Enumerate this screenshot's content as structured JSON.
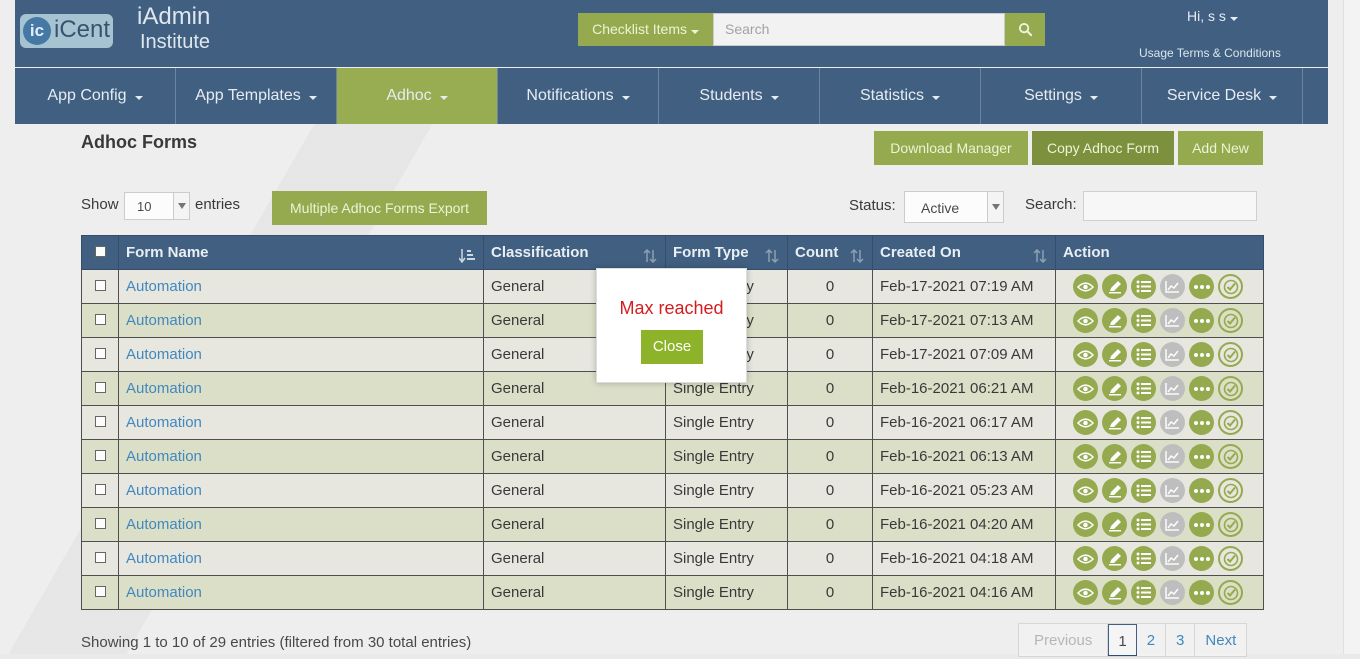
{
  "header": {
    "logo_text": "iCent",
    "logo_mark": "ic",
    "brand_title": "iAdmin",
    "brand_subtitle": "Institute",
    "checklist_button": "Checklist Items",
    "search_placeholder": "Search",
    "greeting": "Hi, s s",
    "terms_link": "Usage Terms & Conditions",
    "colors": {
      "bar": "#2b4e73",
      "accent": "#8aa13a"
    }
  },
  "nav": {
    "items": [
      {
        "label": "App Config"
      },
      {
        "label": "App Templates"
      },
      {
        "label": "Adhoc"
      },
      {
        "label": "Notifications"
      },
      {
        "label": "Students"
      },
      {
        "label": "Statistics"
      },
      {
        "label": "Settings"
      },
      {
        "label": "Service Desk"
      }
    ],
    "active": "Adhoc"
  },
  "page": {
    "title": "Adhoc Forms",
    "buttons": {
      "download_manager": "Download Manager",
      "copy_adhoc_form": "Copy Adhoc Form",
      "add_new": "Add New",
      "multiple_export": "Multiple Adhoc Forms Export"
    },
    "show_label": "Show",
    "entries_value": "10",
    "entries_label": "entries",
    "status_label": "Status:",
    "status_value": "Active",
    "search_label": "Search:"
  },
  "table": {
    "headers": {
      "form_name": "Form Name",
      "classification": "Classification",
      "form_type": "Form Type",
      "count": "Count",
      "created_on": "Created On",
      "action": "Action"
    },
    "rows": [
      {
        "name": "Automation",
        "classification": "General",
        "type": "Single Entry",
        "count": "0",
        "created": "Feb-17-2021 07:19 AM"
      },
      {
        "name": "Automation",
        "classification": "General",
        "type": "Single Entry",
        "count": "0",
        "created": "Feb-17-2021 07:13 AM"
      },
      {
        "name": "Automation",
        "classification": "General",
        "type": "Single Entry",
        "count": "0",
        "created": "Feb-17-2021 07:09 AM"
      },
      {
        "name": "Automation",
        "classification": "General",
        "type": "Single Entry",
        "count": "0",
        "created": "Feb-16-2021 06:21 AM"
      },
      {
        "name": "Automation",
        "classification": "General",
        "type": "Single Entry",
        "count": "0",
        "created": "Feb-16-2021 06:17 AM"
      },
      {
        "name": "Automation",
        "classification": "General",
        "type": "Single Entry",
        "count": "0",
        "created": "Feb-16-2021 06:13 AM"
      },
      {
        "name": "Automation",
        "classification": "General",
        "type": "Single Entry",
        "count": "0",
        "created": "Feb-16-2021 05:23 AM"
      },
      {
        "name": "Automation",
        "classification": "General",
        "type": "Single Entry",
        "count": "0",
        "created": "Feb-16-2021 04:20 AM"
      },
      {
        "name": "Automation",
        "classification": "General",
        "type": "Single Entry",
        "count": "0",
        "created": "Feb-16-2021 04:18 AM"
      },
      {
        "name": "Automation",
        "classification": "General",
        "type": "Single Entry",
        "count": "0",
        "created": "Feb-16-2021 04:16 AM"
      }
    ],
    "action_icons": [
      "eye-icon",
      "edit-icon",
      "list-icon",
      "chart-icon",
      "more-icon",
      "check-icon"
    ]
  },
  "footer": {
    "info": "Showing 1 to 10 of 29 entries (filtered from 30 total entries)",
    "pagination": {
      "previous": "Previous",
      "pages": [
        "1",
        "2",
        "3"
      ],
      "current": "1",
      "next": "Next"
    }
  },
  "modal": {
    "message": "Max reached",
    "close_label": "Close"
  }
}
